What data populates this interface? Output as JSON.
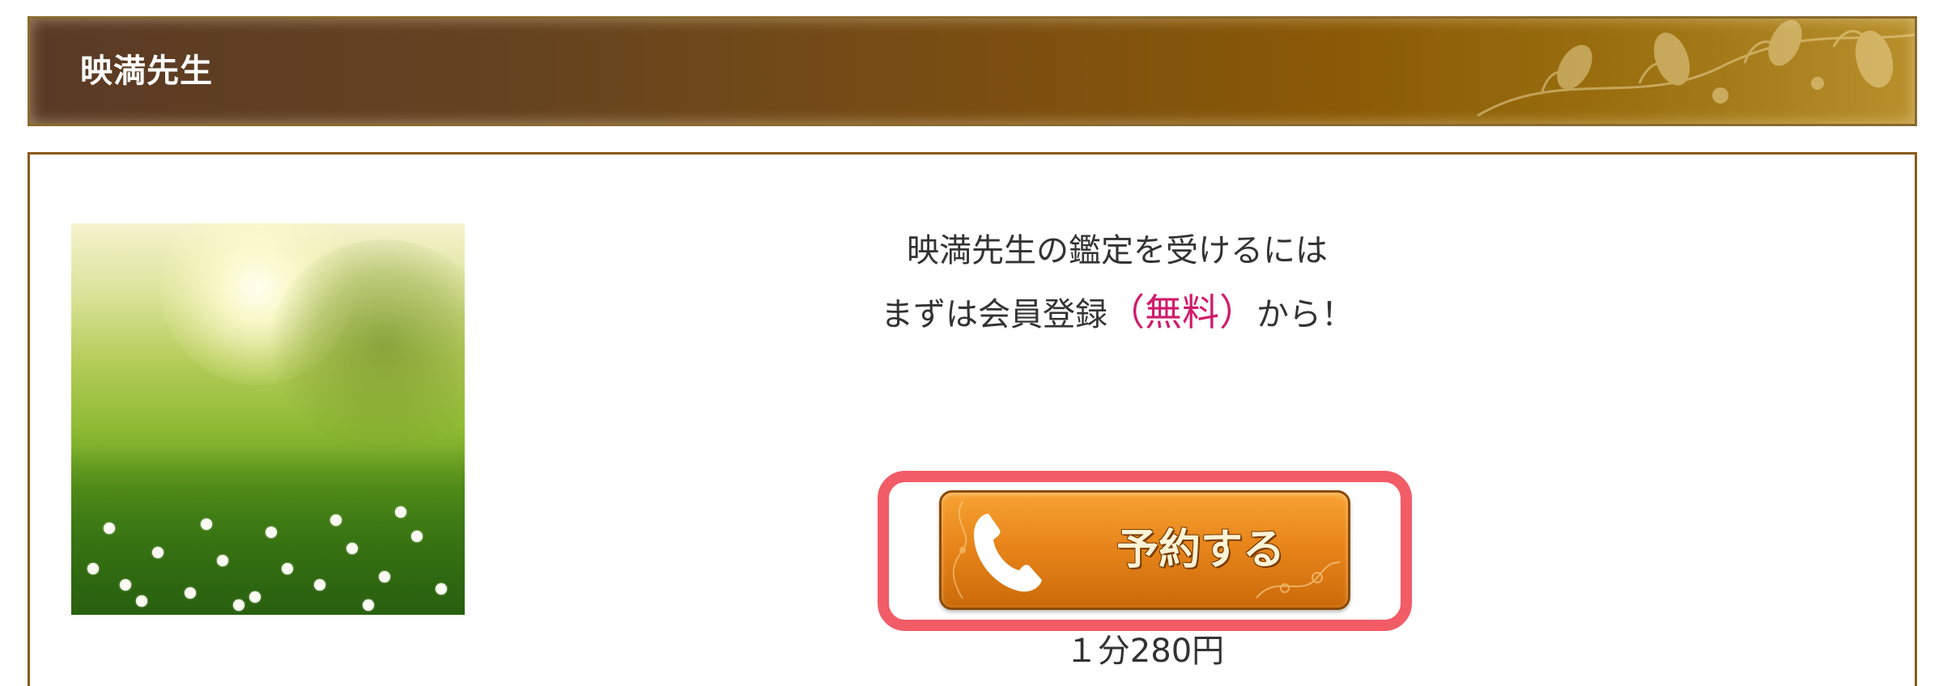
{
  "header": {
    "title": "映満先生"
  },
  "main": {
    "message_line1": "映満先生の鑑定を受けるには",
    "message_line2_prefix": "まずは会員登録",
    "message_line2_highlight": "（無料）",
    "message_line2_suffix": "から！",
    "reserve_button_label": "予約する",
    "price": "１分280円"
  },
  "icons": {
    "reserve_button_icon": "phone-icon"
  },
  "colors": {
    "header_gradient_start": "#5a3a24",
    "header_gradient_end": "#b8902c",
    "content_border": "#8a5a1e",
    "highlight_text": "#d11a6a",
    "button_orange": "#e8861b",
    "focus_ring": "#f25c66"
  }
}
